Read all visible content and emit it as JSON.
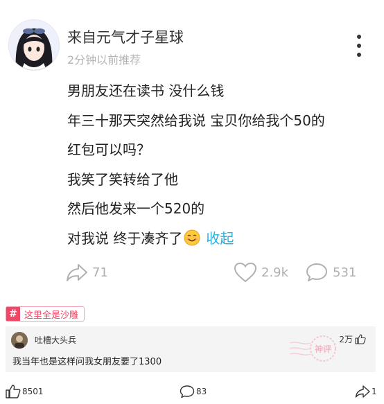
{
  "author": {
    "name": "来自元气才子星球",
    "time_ago": "2分钟以前推荐"
  },
  "post": {
    "lines": [
      "男朋友还在读书 没什么钱",
      "年三十那天突然给我说 宝贝你给我个50的",
      "红包可以吗？",
      "我笑了笑转给了他",
      "然后他发来一个520的",
      "对我说  终于凑齐了"
    ],
    "collapse_label": "收起"
  },
  "stats": {
    "shares": "71",
    "likes": "2.9k",
    "comments": "531"
  },
  "tag": {
    "hash_symbol": "#",
    "label": "这里全是沙雕"
  },
  "top_comment": {
    "user": "吐槽大头兵",
    "likes": "2万",
    "text": "我当年也是这样问我女朋友要了1300",
    "stamp_text": "神评"
  },
  "bottom_bar": {
    "likes": "8501",
    "comments": "83",
    "shares": "1"
  },
  "colors": {
    "accent_blue": "#28b1e0",
    "tag_red": "#ef4866"
  }
}
